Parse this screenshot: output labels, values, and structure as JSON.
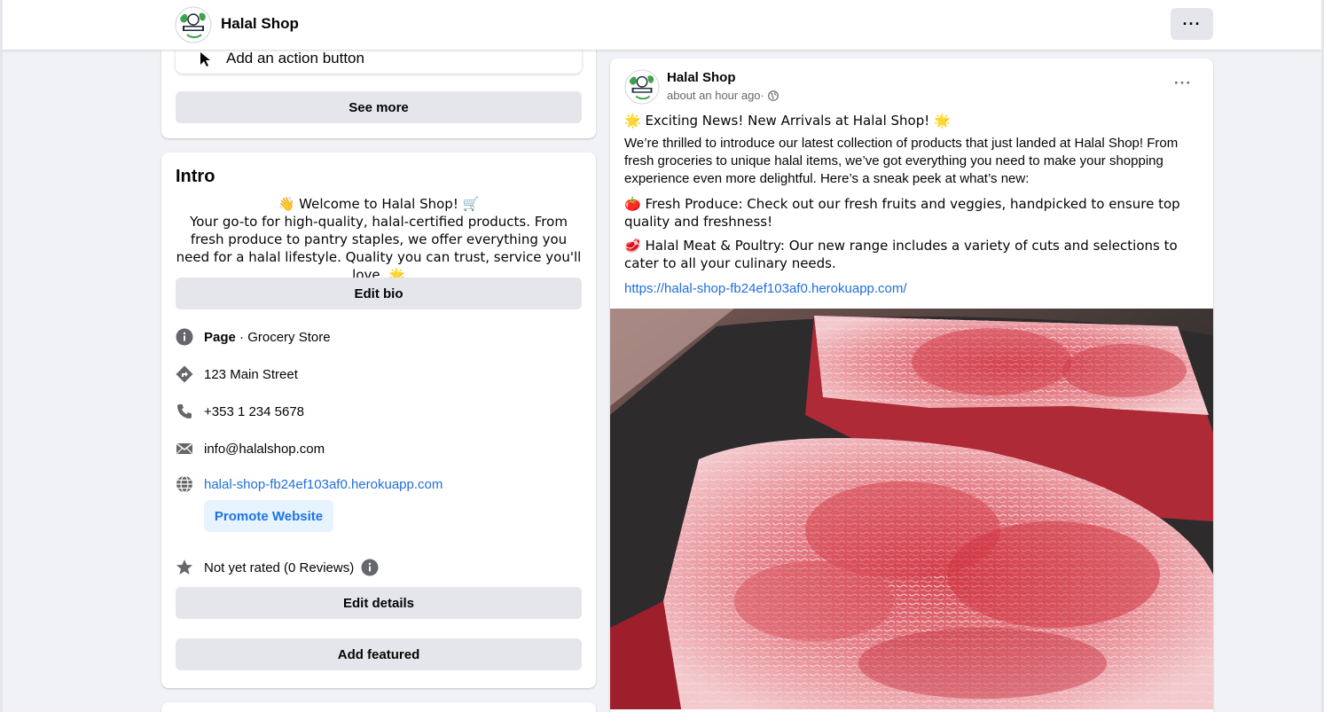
{
  "header": {
    "page_name": "Halal Shop",
    "more_icon": "more-horizontal-icon",
    "logo_icon": "halal-shop-logo-icon"
  },
  "action_card": {
    "action_label": "Add an action button",
    "see_more_label": "See more"
  },
  "intro": {
    "title": "Intro",
    "bio_line1": "👋 Welcome to Halal Shop! 🛒",
    "bio_rest": "Your go-to for high-quality, halal-certified products. From fresh produce to pantry staples, we offer everything you need for a halal lifestyle. Quality you can trust, service you'll love. 🌟",
    "edit_bio_label": "Edit bio",
    "page_type_bold": "Page",
    "page_type_rest": " · Grocery Store",
    "address": "123 Main Street",
    "phone": "+353 1 234 5678",
    "email": "info@halalshop.com",
    "website": "halal-shop-fb24ef103af0.herokuapp.com",
    "promote_label": "Promote Website",
    "rating": "Not yet rated (0 Reviews)",
    "edit_details_label": "Edit details",
    "add_featured_label": "Add featured"
  },
  "post": {
    "author": "Halal Shop",
    "time": "about an hour ago",
    "separator": " · ",
    "headline": "🌟 Exciting News! New Arrivals at Halal Shop! 🌟",
    "paragraph": "We’re thrilled to introduce our latest collection of products that just landed at Halal Shop! From fresh groceries to unique halal items, we’ve got everything you need to make your shopping experience even more delightful. Here’s a sneak peek at what’s new:",
    "produce": "🍅 Fresh Produce: Check out our fresh fruits and veggies, handpicked to ensure top quality and freshness!",
    "meat": "🥩 Halal Meat & Poultry: Our new range includes a variety of cuts and selections to cater to all your culinary needs.",
    "link": "https://halal-shop-fb24ef103af0.herokuapp.com/",
    "image_icon": "raw-steak-photo"
  },
  "colors": {
    "link": "#216fdb",
    "promote_bg": "#e7f3ff",
    "button_grey": "#e4e6eb",
    "page_bg": "#f0f2f5"
  }
}
